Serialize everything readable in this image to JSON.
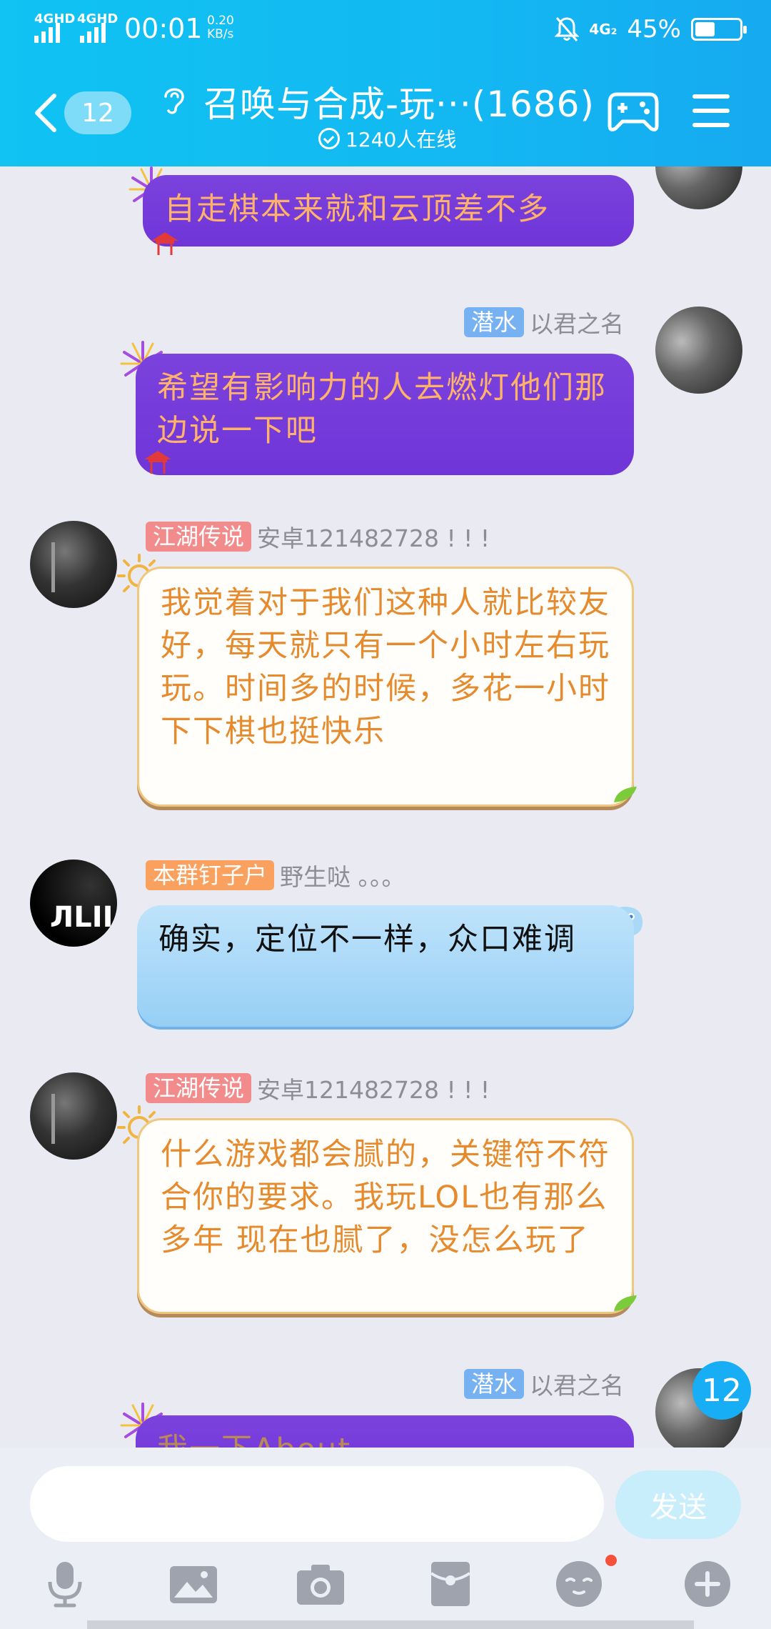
{
  "status_bar": {
    "net1": "4G",
    "net1_sup": "HD",
    "net2": "4G",
    "net2_sup": "HD",
    "time": "00:01",
    "speed_value": "0.20",
    "speed_unit": "KB/s",
    "net3": "4G₂",
    "battery": "45%",
    "battery_level": 0.45
  },
  "header": {
    "unread_count": "12",
    "title": "召唤与合成-玩···(1686)",
    "online": "1240人在线"
  },
  "messages": [
    {
      "side": "right",
      "style": "purple",
      "text": "自走棋本来就和云顶差不多"
    },
    {
      "side": "right",
      "style": "purple",
      "tag": "潜水",
      "tag_color": "blue",
      "nick": "以君之名",
      "text": "希望有影响力的人去燃灯他们那边说一下吧"
    },
    {
      "side": "left",
      "style": "cream",
      "tag": "江湖传说",
      "tag_color": "pink",
      "nick": "安卓121482728 ! ! !",
      "text": "我觉着对于我们这种人就比较友好，每天就只有一个小时左右玩玩。时间多的时候，多花一小时下下棋也挺快乐"
    },
    {
      "side": "left",
      "style": "blue",
      "tag": "本群钉子户",
      "tag_color": "orange",
      "nick": "野生哒  。。。",
      "avatar_text": "ЛLII",
      "text": "确实，定位不一样，众口难调"
    },
    {
      "side": "left",
      "style": "cream",
      "tag": "江湖传说",
      "tag_color": "pink",
      "nick": "安卓121482728 ! ! !",
      "text": "什么游戏都会腻的，关键符不符合你的要求。我玩LOL也有那么多年 现在也腻了，没怎么玩了"
    },
    {
      "side": "right",
      "style": "purple",
      "tag": "潜水",
      "tag_color": "blue",
      "nick": "以君之名",
      "text": "我一下About ..."
    }
  ],
  "floating_badge": "12",
  "input_bar": {
    "placeholder": "",
    "send_label": "发送"
  },
  "toolbar_icons": [
    "microphone-icon",
    "image-icon",
    "camera-icon",
    "red-packet-icon",
    "emoji-icon",
    "plus-icon"
  ],
  "colors": {
    "header": "#13b8f2",
    "purple_bubble": "#7040d9",
    "cream_text": "#e68a2e",
    "blue_bubble": "#a8d8f8"
  }
}
